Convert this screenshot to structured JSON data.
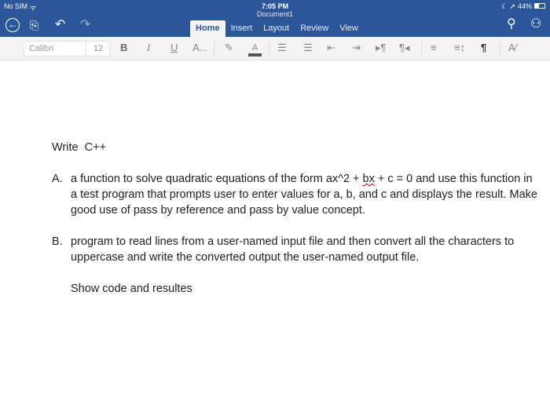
{
  "status": {
    "carrier": "No SIM",
    "time": "7:05 PM",
    "battery": "44%"
  },
  "document_title": "Document1",
  "tabs": [
    "Home",
    "Insert",
    "Layout",
    "Review",
    "View"
  ],
  "toolbar": {
    "font": "Calibri",
    "size": "12",
    "bold": "B",
    "italic": "I",
    "underline": "U",
    "more_font": "A...",
    "font_color": "A",
    "pilcrow": "¶"
  },
  "doc": {
    "heading": "Write  C++",
    "a_marker": "A.",
    "a_text_1": "a function to solve quadratic equations  of the form ax^2 + ",
    "a_text_sq": "bx",
    "a_text_2": " + c = 0 and use this function in a test program that prompts user to enter values for a, b, and c and displays the result. Make good use of pass by reference and pass by value concept.",
    "b_marker": "B.",
    "b_text": " program to read lines from a user-named input file and then convert all the characters to uppercase and write the converted output the user-named output file.",
    "closing": "Show code and resultes"
  }
}
